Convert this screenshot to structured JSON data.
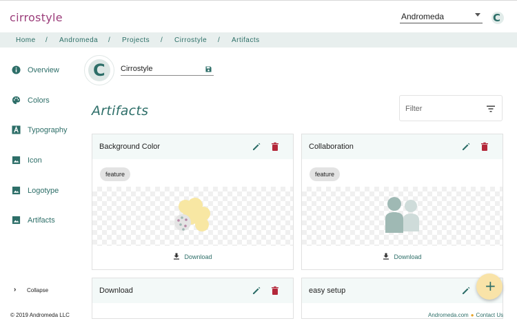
{
  "app": {
    "logo": "cirrostyle",
    "project_select": "Andromeda",
    "user_avatar_letter": "C"
  },
  "breadcrumb": {
    "items": [
      "Home",
      "Andromeda",
      "Projects",
      "Cirrostyle",
      "Artifacts"
    ],
    "separator": "/"
  },
  "sidebar": {
    "items": [
      {
        "label": "Overview",
        "icon": "info-icon"
      },
      {
        "label": "Colors",
        "icon": "palette-icon"
      },
      {
        "label": "Typography",
        "icon": "typography-icon"
      },
      {
        "label": "Icon",
        "icon": "image-icon"
      },
      {
        "label": "Logotype",
        "icon": "image-icon"
      },
      {
        "label": "Artifacts",
        "icon": "image-icon"
      }
    ],
    "collapse_label": "Collapse"
  },
  "project": {
    "avatar_letter": "C",
    "name": "Cirrostyle"
  },
  "main": {
    "title": "Artifacts",
    "filter_placeholder": "Filter"
  },
  "cards": [
    {
      "title": "Background Color",
      "tag": "feature",
      "download": "Download",
      "preview": "palette-illustration"
    },
    {
      "title": "Collaboration",
      "tag": "feature",
      "download": "Download",
      "preview": "people-illustration"
    },
    {
      "title": "Download"
    },
    {
      "title": "easy setup"
    }
  ],
  "fab": {
    "label": "+"
  },
  "footer": {
    "copyright": "© 2019 Andromeda LLC",
    "links": [
      "Andromeda.com",
      "Contact Us"
    ]
  },
  "colors": {
    "brand_teal": "#2d6e68",
    "logo_purple": "#9b3d7a",
    "delete_red": "#b3283a",
    "fab_yellow": "#f9e3a8"
  }
}
